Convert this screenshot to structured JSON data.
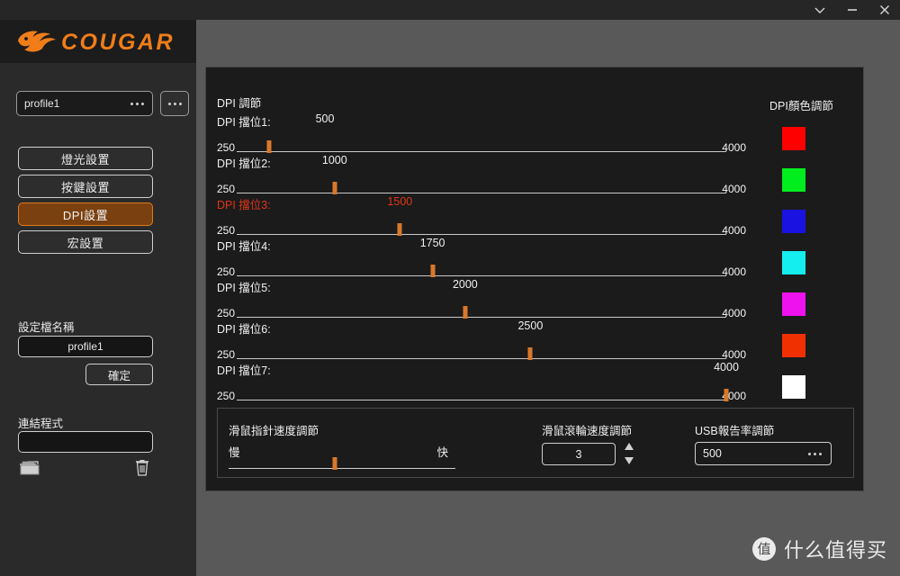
{
  "window": {
    "controls": [
      {
        "name": "minimize-to-tray",
        "icon": "chevron-down-icon"
      },
      {
        "name": "minimize",
        "icon": "minus-icon"
      },
      {
        "name": "close",
        "icon": "close-icon"
      }
    ]
  },
  "brand": {
    "logo_text": "COUGAR",
    "logo_color": "#F07D1A"
  },
  "sidebar": {
    "profile": {
      "value": "profile1",
      "more_icon": "ellipsis-icon"
    },
    "nav": [
      {
        "label": "燈光設置",
        "active": false
      },
      {
        "label": "按鍵設置",
        "active": false
      },
      {
        "label": "DPI設置",
        "active": true
      },
      {
        "label": "宏設置",
        "active": false
      }
    ],
    "profile_name": {
      "label": "設定檔名稱",
      "value": "profile1",
      "confirm_label": "確定"
    },
    "link_program": {
      "label": "連結程式",
      "value": "",
      "folder_icon": "folder-icon",
      "trash_icon": "trash-icon"
    }
  },
  "main": {
    "dpi_section_title": "DPI 調節",
    "color_section_title": "DPI顏色調節",
    "slider_min_label": "250",
    "slider_max_label": "4000",
    "dpi_stages": [
      {
        "label": "DPI 擋位1:",
        "value": "500",
        "num": 500,
        "color": "#FF0000",
        "selected": false
      },
      {
        "label": "DPI 擋位2:",
        "value": "1000",
        "num": 1000,
        "color": "#00EE1E",
        "selected": false
      },
      {
        "label": "DPI 擋位3:",
        "value": "1500",
        "num": 1500,
        "color": "#1A12E0",
        "selected": true
      },
      {
        "label": "DPI 擋位4:",
        "value": "1750",
        "num": 1750,
        "color": "#14EEEE",
        "selected": false
      },
      {
        "label": "DPI 擋位5:",
        "value": "2000",
        "num": 2000,
        "color": "#EE12EE",
        "selected": false
      },
      {
        "label": "DPI 擋位6:",
        "value": "2500",
        "num": 2500,
        "color": "#F03000",
        "selected": false
      },
      {
        "label": "DPI 擋位7:",
        "value": "4000",
        "num": 4000,
        "color": "#FFFFFF",
        "selected": false
      }
    ],
    "range": {
      "min": 250,
      "max": 4000
    },
    "selected_color": "#E03418",
    "accent_color": "#D9782B"
  },
  "bottom": {
    "pointer_speed": {
      "label": "滑鼠指針速度調節",
      "slow_label": "慢",
      "fast_label": "快",
      "percent": 47
    },
    "scroll_speed": {
      "label": "滑鼠滾輪速度調節",
      "value": "3",
      "spinner_icon": "spinner-updown-icon"
    },
    "usb_rate": {
      "label": "USB報告率調節",
      "value": "500",
      "more_icon": "ellipsis-icon"
    }
  },
  "watermark": {
    "badge": "值",
    "text": "什么值得买"
  }
}
